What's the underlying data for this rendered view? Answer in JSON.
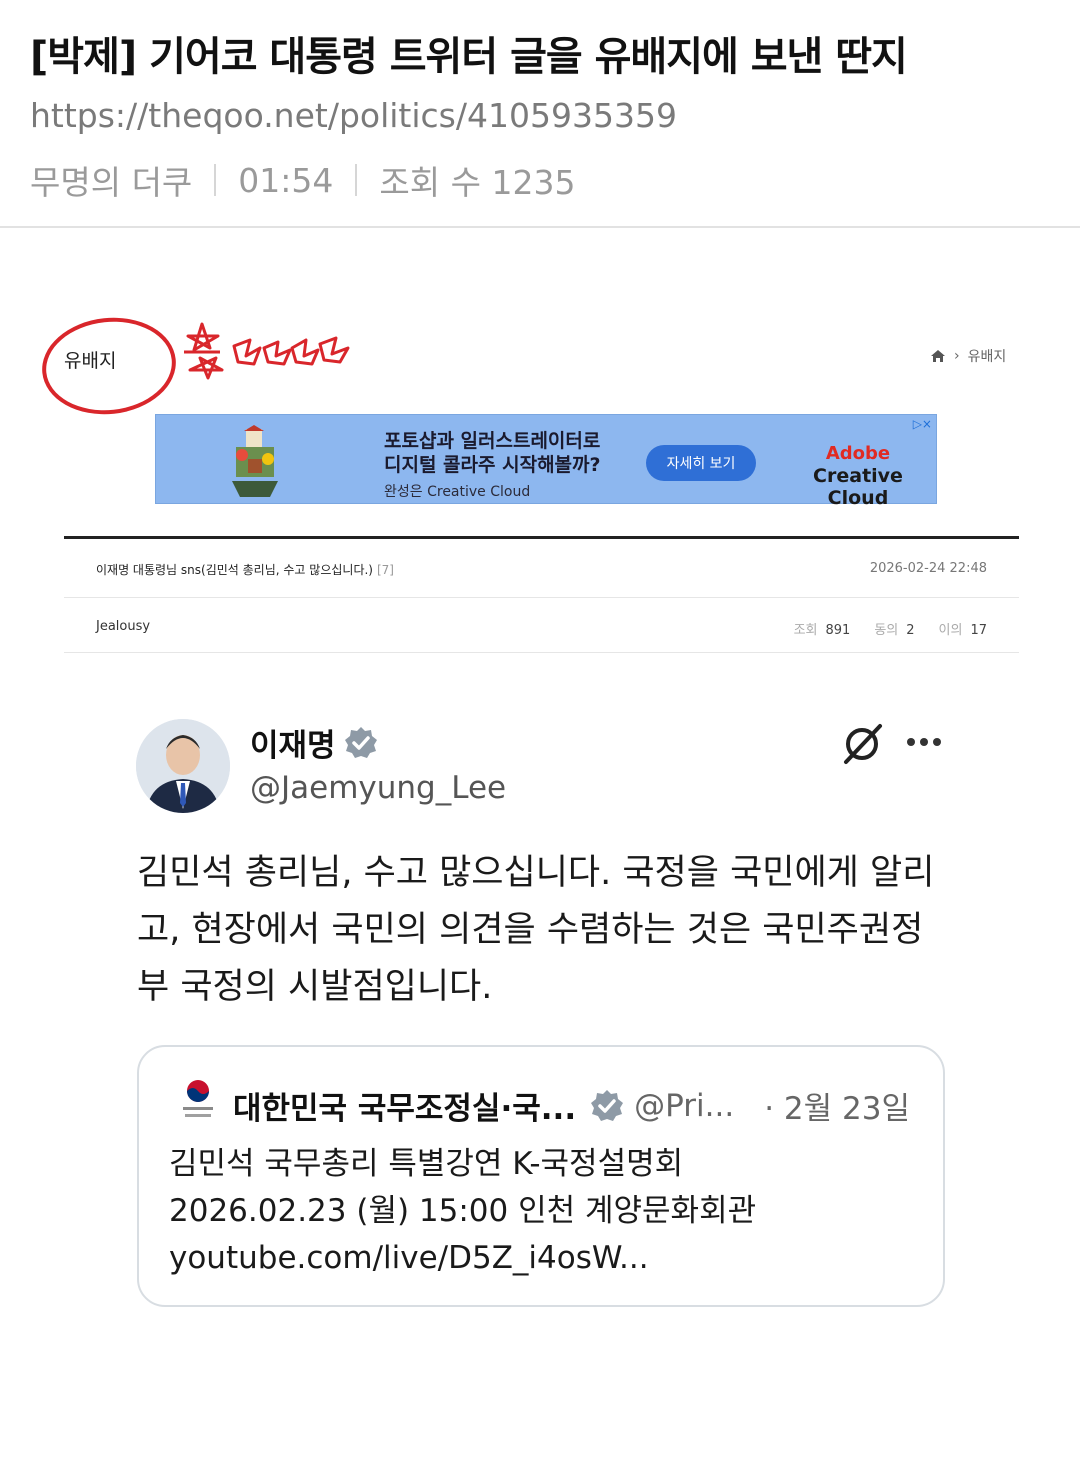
{
  "post": {
    "title": "[박제] 기어코 대통령 트위터 글을 유배지에 보낸 딴지",
    "url": "https://theqoo.net/politics/4105935359",
    "author": "무명의 더쿠",
    "time": "01:54",
    "views": "조회 수 1235"
  },
  "board": {
    "name": "유배지",
    "breadcrumb_current": "유배지",
    "ad": {
      "headline1": "포토샵과 일러스트레이터로",
      "headline2": "디지털 콜라주 시작해볼까?",
      "sub": "완성은 Creative Cloud",
      "button": "자세히 보기",
      "brand1": "Adobe",
      "brand2": "Creative Cloud"
    },
    "post_title": "이재명 대통령님 sns(김민석 총리님, 수고 많으십니다.)",
    "comment_count": "[7]",
    "date": "2026-02-24 22:48",
    "author": "Jealousy",
    "views_label": "조회",
    "views": "891",
    "agree_label": "동의",
    "agree": "2",
    "disagree_label": "이의",
    "disagree": "17"
  },
  "tweet": {
    "name": "이재명",
    "handle": "@Jaemyung_Lee",
    "body": "김민석 총리님, 수고 많으십니다. 국정을 국민에게 알리고, 현장에서 국민의 의견을 수렴하는 것은 국민주권정부 국정의 시발점입니다.",
    "quote": {
      "name": "대한민국 국무조정실·국...",
      "handle": "@Pri...",
      "date": "· 2월 23일",
      "line1": "김민석 국무총리 특별강연 K-국정설명회",
      "line2": "2026.02.23 (월) 15:00 인천 계양문화회관",
      "line3": "youtube.com/live/D5Z_i4osW..."
    }
  },
  "colors": {
    "annotation_red": "#d9262b",
    "ad_background": "#8db7ef",
    "verified_badge": "#8e9aa6"
  }
}
